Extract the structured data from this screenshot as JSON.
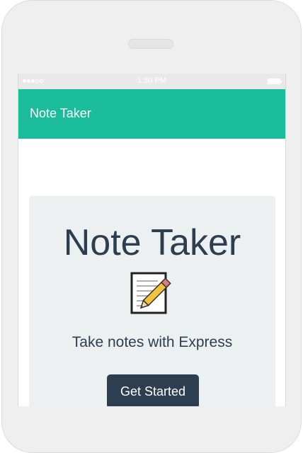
{
  "status_bar": {
    "time": "1:30 PM",
    "signal_icon": "signal-dots-icon",
    "battery_icon": "battery-icon"
  },
  "navbar": {
    "brand": "Note Taker",
    "background": "#1abc9c"
  },
  "jumbotron": {
    "title": "Note Taker",
    "icon": "memo-icon",
    "tagline": "Take notes with Express",
    "button_label": "Get Started",
    "button_color": "#2c3e50"
  },
  "colors": {
    "accent": "#1abc9c",
    "text_dark": "#2c3e50",
    "panel_bg": "#ecf0f1"
  }
}
